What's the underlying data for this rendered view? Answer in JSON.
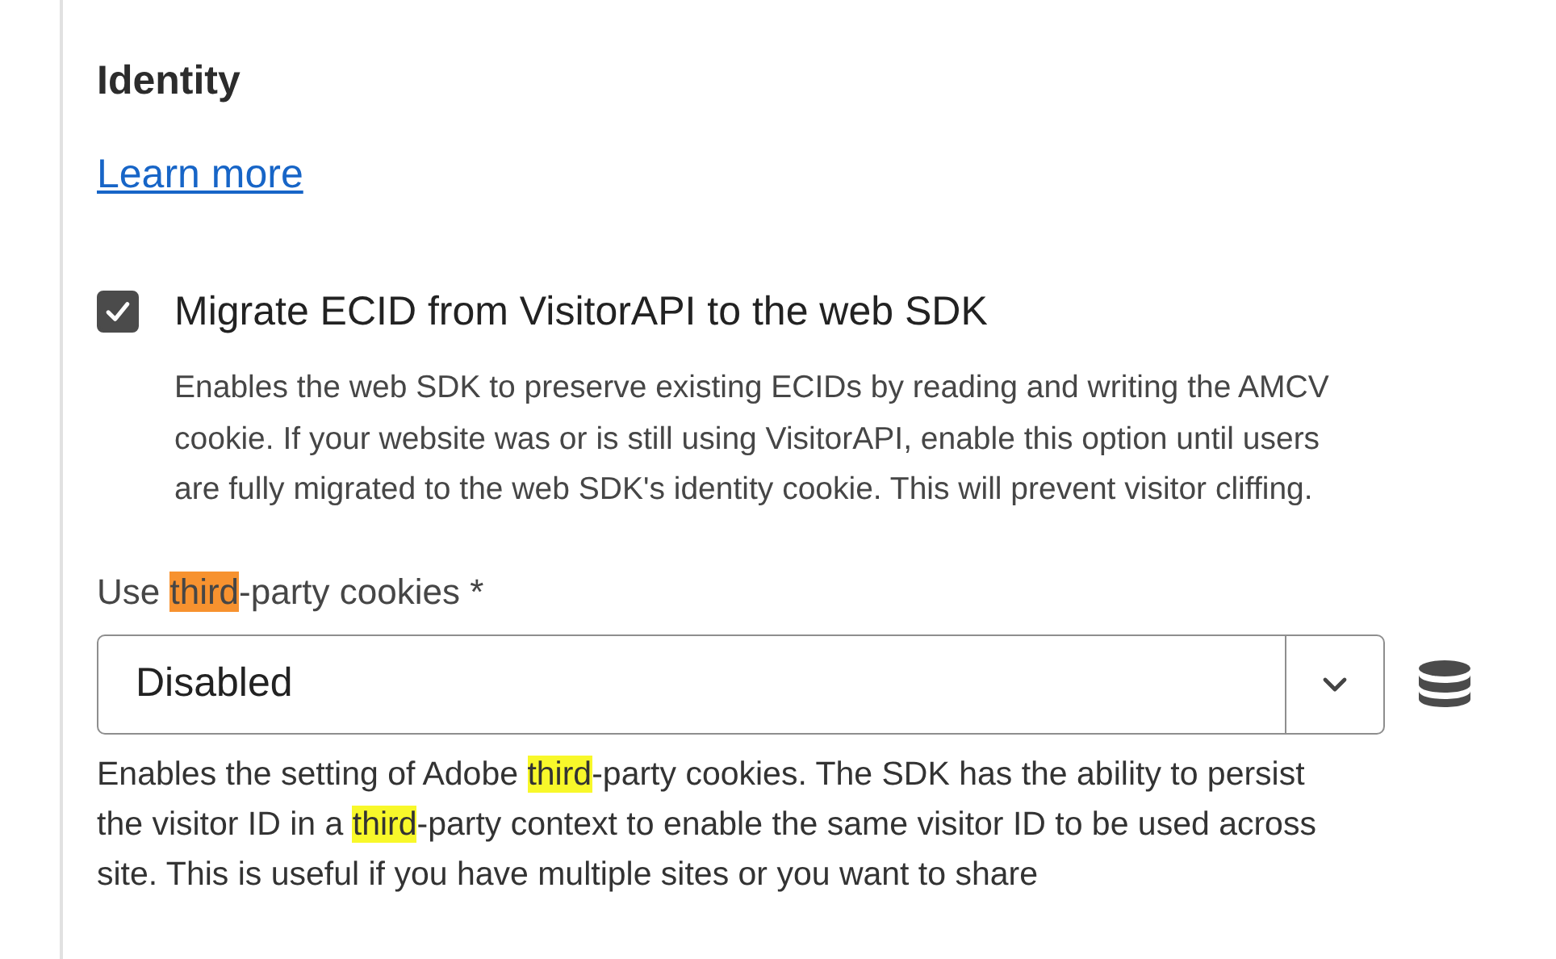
{
  "section": {
    "title": "Identity",
    "link": "Learn more"
  },
  "checkbox": {
    "label": "Migrate ECID from VisitorAPI to the web SDK",
    "checked": true,
    "description": "Enables the web SDK to preserve existing ECIDs by reading and writing the AMCV cookie. If your website was or is still using VisitorAPI, enable this option until users are fully migrated to the web SDK's identity cookie. This will prevent visitor cliffing."
  },
  "select": {
    "label": [
      {
        "text": "Use ",
        "highlighted": false
      },
      {
        "text": "third",
        "highlighted": true,
        "current": true
      },
      {
        "text": "-party cookies",
        "highlighted": false
      }
    ],
    "required": "*",
    "value": "Disabled",
    "description": [
      {
        "text": "Enables the setting of Adobe ",
        "highlighted": false
      },
      {
        "text": "third",
        "highlighted": true,
        "current": false
      },
      {
        "text": "-party cookies. The SDK has the ability to persist the visitor ID in a ",
        "highlighted": false
      },
      {
        "text": "third",
        "highlighted": true,
        "current": false
      },
      {
        "text": "-party context to enable the same visitor ID to be used across site. This is useful if you have multiple sites or you want to share",
        "highlighted": false
      }
    ]
  }
}
